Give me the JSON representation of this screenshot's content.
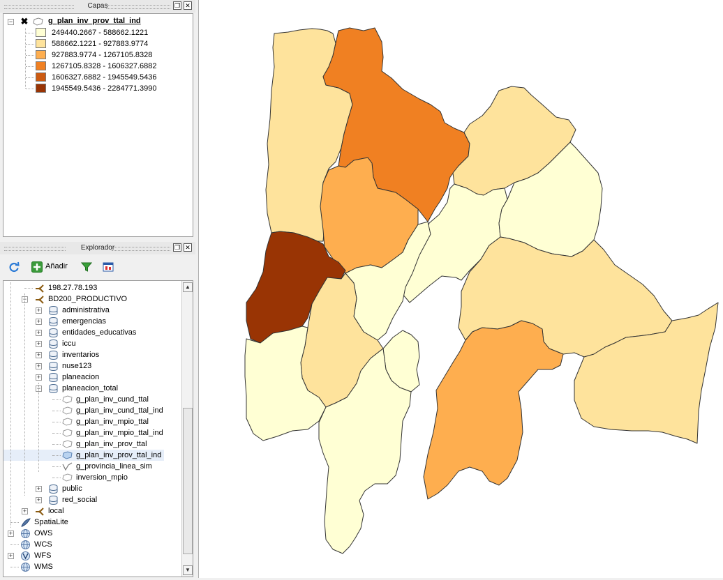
{
  "layers_panel": {
    "title": "Capas",
    "layer_name": "g_plan_inv_prov_ttal_ind",
    "legend": [
      {
        "label": "249440.2667 - 588662.1221",
        "color": "#ffffd4"
      },
      {
        "label": "588662.1221 - 927883.9774",
        "color": "#fee39c"
      },
      {
        "label": "927883.9774 - 1267105.8328",
        "color": "#feae4f"
      },
      {
        "label": "1267105.8328 - 1606327.6882",
        "color": "#f08022"
      },
      {
        "label": "1606327.6882 - 1945549.5436",
        "color": "#cc5a11"
      },
      {
        "label": "1945549.5436 - 2284771.3990",
        "color": "#993404"
      }
    ]
  },
  "explorer_panel": {
    "title": "Explorador",
    "toolbar": {
      "refresh_icon": "refresh-icon",
      "add_label": "Añadir",
      "filter_icon": "filter-icon",
      "properties_icon": "properties-icon"
    },
    "tree": [
      {
        "label": "198.27.78.193",
        "icon": "connection-icon"
      },
      {
        "label": "BD200_PRODUCTIVO",
        "icon": "connection-icon"
      },
      {
        "label": "administrativa",
        "icon": "schema-icon"
      },
      {
        "label": "emergencias",
        "icon": "schema-icon"
      },
      {
        "label": "entidades_educativas",
        "icon": "schema-icon"
      },
      {
        "label": "iccu",
        "icon": "schema-icon"
      },
      {
        "label": "inventarios",
        "icon": "schema-icon"
      },
      {
        "label": "nuse123",
        "icon": "schema-icon"
      },
      {
        "label": "planeacion",
        "icon": "schema-icon"
      },
      {
        "label": "planeacion_total",
        "icon": "schema-icon"
      },
      {
        "label": "g_plan_inv_cund_ttal",
        "icon": "polygon-layer-icon"
      },
      {
        "label": "g_plan_inv_cund_ttal_ind",
        "icon": "polygon-layer-icon"
      },
      {
        "label": "g_plan_inv_mpio_ttal",
        "icon": "polygon-layer-icon"
      },
      {
        "label": "g_plan_inv_mpio_ttal_ind",
        "icon": "polygon-layer-icon"
      },
      {
        "label": "g_plan_inv_prov_ttal",
        "icon": "polygon-layer-icon"
      },
      {
        "label": "g_plan_inv_prov_ttal_ind",
        "icon": "polygon-layer-icon"
      },
      {
        "label": "g_provincia_linea_sim",
        "icon": "line-layer-icon"
      },
      {
        "label": "inversion_mpio",
        "icon": "polygon-layer-icon"
      },
      {
        "label": "public",
        "icon": "schema-icon"
      },
      {
        "label": "red_social",
        "icon": "schema-icon"
      },
      {
        "label": "local",
        "icon": "connection-icon"
      },
      {
        "label": "SpatiaLite",
        "icon": "spatialite-icon"
      },
      {
        "label": "OWS",
        "icon": "globe-icon"
      },
      {
        "label": "WCS",
        "icon": "globe-icon"
      },
      {
        "label": "WFS",
        "icon": "wfs-icon"
      },
      {
        "label": "WMS",
        "icon": "globe-icon"
      }
    ]
  },
  "map": {
    "outline_color": "#333333",
    "background": "#ffffff"
  }
}
